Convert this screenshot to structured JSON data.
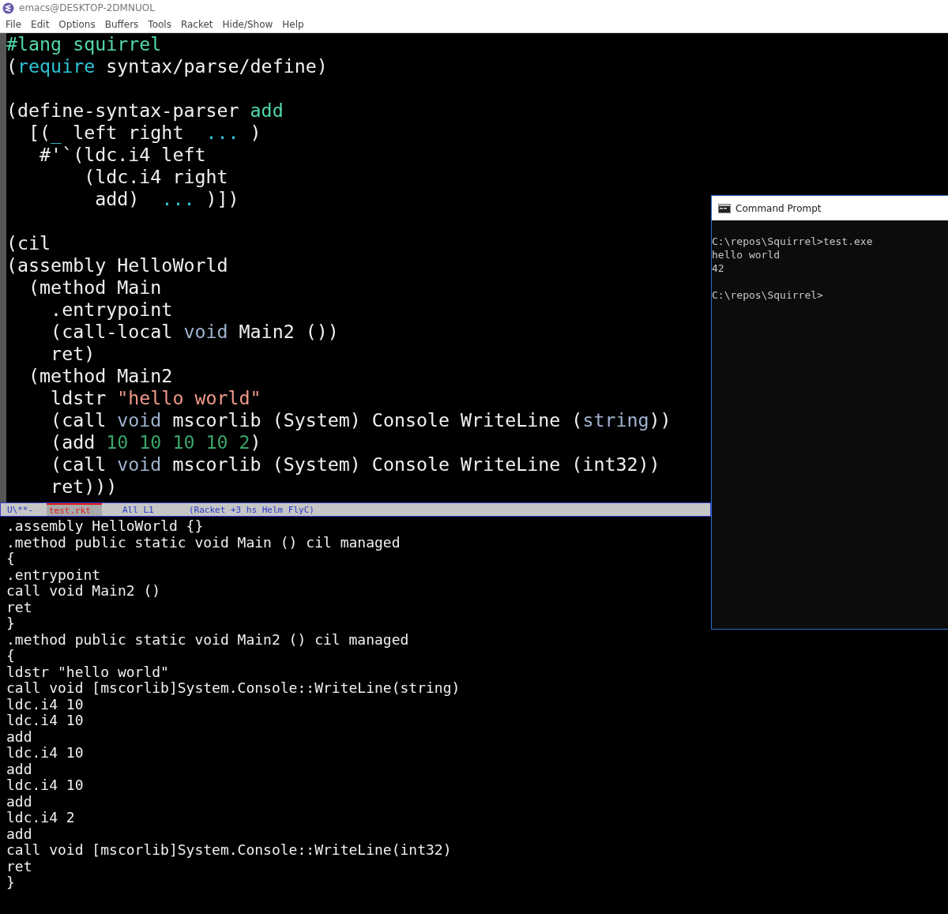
{
  "window": {
    "title": "emacs@DESKTOP-2DMNUOL"
  },
  "menu": [
    "File",
    "Edit",
    "Options",
    "Buffers",
    "Tools",
    "Racket",
    "Hide/Show",
    "Help"
  ],
  "source_buffer": {
    "lines": [
      {
        "kind": "code",
        "segments": [
          {
            "kind": "lang",
            "text": "#lang squirrel"
          }
        ]
      },
      {
        "kind": "code",
        "segments": [
          {
            "kind": "plain",
            "text": "("
          },
          {
            "kind": "keyword",
            "text": "require"
          },
          {
            "kind": "plain",
            "text": " syntax/parse/define)"
          }
        ]
      },
      {
        "kind": "blank"
      },
      {
        "kind": "code",
        "segments": [
          {
            "kind": "plain",
            "text": "(define-syntax-parser "
          },
          {
            "kind": "name",
            "text": "add"
          }
        ]
      },
      {
        "kind": "code",
        "segments": [
          {
            "kind": "plain",
            "text": "  [("
          },
          {
            "kind": "keyword",
            "text": "_"
          },
          {
            "kind": "plain",
            "text": " left right  "
          },
          {
            "kind": "keyword",
            "text": "..."
          },
          {
            "kind": "plain",
            "text": " )"
          }
        ]
      },
      {
        "kind": "code",
        "segments": [
          {
            "kind": "plain",
            "text": "   #'`(ldc.i4 left"
          }
        ]
      },
      {
        "kind": "code",
        "segments": [
          {
            "kind": "plain",
            "text": "       (ldc.i4 right"
          }
        ]
      },
      {
        "kind": "code",
        "segments": [
          {
            "kind": "plain",
            "text": "        add)  "
          },
          {
            "kind": "keyword",
            "text": "..."
          },
          {
            "kind": "plain",
            "text": " )])"
          }
        ]
      },
      {
        "kind": "blank"
      },
      {
        "kind": "code",
        "segments": [
          {
            "kind": "plain",
            "text": "(cil"
          }
        ]
      },
      {
        "kind": "code",
        "segments": [
          {
            "kind": "plain",
            "text": "(assembly HelloWorld"
          }
        ]
      },
      {
        "kind": "code",
        "segments": [
          {
            "kind": "plain",
            "text": "  (method Main"
          }
        ]
      },
      {
        "kind": "code",
        "segments": [
          {
            "kind": "plain",
            "text": "    .entrypoint"
          }
        ]
      },
      {
        "kind": "code",
        "segments": [
          {
            "kind": "plain",
            "text": "    (call-local "
          },
          {
            "kind": "type",
            "text": "void"
          },
          {
            "kind": "plain",
            "text": " Main2 ())"
          }
        ]
      },
      {
        "kind": "code",
        "segments": [
          {
            "kind": "plain",
            "text": "    ret)"
          }
        ]
      },
      {
        "kind": "code",
        "segments": [
          {
            "kind": "plain",
            "text": "  (method Main2"
          }
        ]
      },
      {
        "kind": "code",
        "segments": [
          {
            "kind": "plain",
            "text": "    ldstr "
          },
          {
            "kind": "string",
            "text": "\"hello world\""
          }
        ]
      },
      {
        "kind": "code",
        "segments": [
          {
            "kind": "plain",
            "text": "    (call "
          },
          {
            "kind": "type",
            "text": "void"
          },
          {
            "kind": "plain",
            "text": " mscorlib (System) Console WriteLine ("
          },
          {
            "kind": "type",
            "text": "string"
          },
          {
            "kind": "plain",
            "text": "))"
          }
        ]
      },
      {
        "kind": "code",
        "segments": [
          {
            "kind": "plain",
            "text": "    (add "
          },
          {
            "kind": "number",
            "text": "10 10 10 10 2"
          },
          {
            "kind": "plain",
            "text": ")"
          }
        ]
      },
      {
        "kind": "code",
        "segments": [
          {
            "kind": "plain",
            "text": "    (call "
          },
          {
            "kind": "type",
            "text": "void"
          },
          {
            "kind": "plain",
            "text": " mscorlib (System) Console WriteLine (int32))"
          }
        ]
      },
      {
        "kind": "code",
        "segments": [
          {
            "kind": "plain",
            "text": "    ret)))"
          }
        ]
      }
    ]
  },
  "mode_line": {
    "state": "U\\**-",
    "buffer_name": "test.rkt",
    "position": "All L1",
    "modes": "(Racket +3 hs Helm FlyC)"
  },
  "output_buffer": {
    "lines": [
      ".assembly HelloWorld {}",
      ".method public static void Main () cil managed",
      "{",
      ".entrypoint",
      "call void Main2 ()",
      "ret",
      "}",
      ".method public static void Main2 () cil managed",
      "{",
      "ldstr \"hello world\"",
      "call void [mscorlib]System.Console::WriteLine(string)",
      "ldc.i4 10",
      "ldc.i4 10",
      "add",
      "ldc.i4 10",
      "add",
      "ldc.i4 10",
      "add",
      "ldc.i4 2",
      "add",
      "call void [mscorlib]System.Console::WriteLine(int32)",
      "ret",
      "}"
    ]
  },
  "command_prompt": {
    "title": "Command Prompt",
    "output": [
      "C:\\repos\\Squirrel>test.exe",
      "hello world",
      "42"
    ],
    "prompt": "C:\\repos\\Squirrel>"
  }
}
